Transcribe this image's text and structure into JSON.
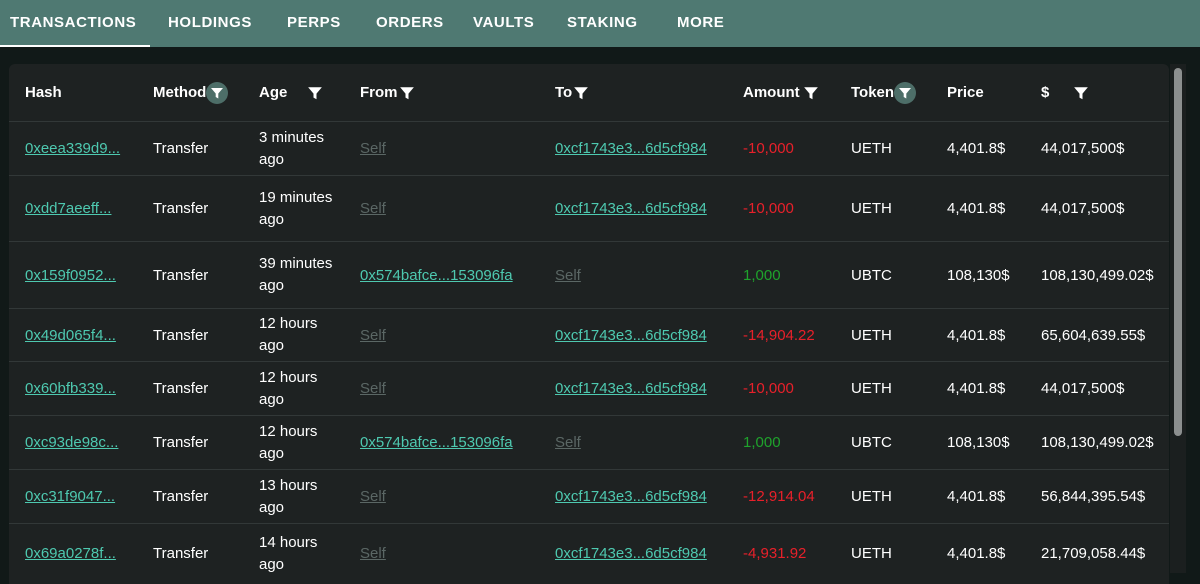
{
  "tabs": [
    {
      "label": "TRANSACTIONS"
    },
    {
      "label": "HOLDINGS"
    },
    {
      "label": "PERPS"
    },
    {
      "label": "ORDERS"
    },
    {
      "label": "VAULTS"
    },
    {
      "label": "STAKING"
    },
    {
      "label": "MORE"
    }
  ],
  "active_tab": "TRANSACTIONS",
  "colors": {
    "tabbar": "#4f7972",
    "link": "#4ec9b0",
    "negative": "#e8202a",
    "positive": "#1fa32c",
    "self_link": "#5b6765"
  },
  "table": {
    "headers": {
      "hash": "Hash",
      "method": "Method",
      "age": "Age",
      "from": "From",
      "to": "To",
      "amount": "Amount",
      "token": "Token",
      "price": "Price",
      "usd": "$"
    },
    "filter_icon": "funnel-icon",
    "rows": [
      {
        "hash": "0xeea339d9...",
        "method": "Transfer",
        "age": "3 minutes ago",
        "from": "Self",
        "to": "0xcf1743e3...6d5cf984",
        "amount": "-10,000",
        "token": "UETH",
        "price": "4,401.8$",
        "usd": "44,017,500$"
      },
      {
        "hash": "0xdd7aeeff...",
        "method": "Transfer",
        "age": "19 minutes ago",
        "from": "Self",
        "to": "0xcf1743e3...6d5cf984",
        "amount": "-10,000",
        "token": "UETH",
        "price": "4,401.8$",
        "usd": "44,017,500$"
      },
      {
        "hash": "0x159f0952...",
        "method": "Transfer",
        "age": "39 minutes ago",
        "from": "0x574bafce...153096fa",
        "to": "Self",
        "amount": "1,000",
        "token": "UBTC",
        "price": "108,130$",
        "usd": "108,130,499.02$"
      },
      {
        "hash": "0x49d065f4...",
        "method": "Transfer",
        "age": "12 hours ago",
        "from": "Self",
        "to": "0xcf1743e3...6d5cf984",
        "amount": "-14,904.22",
        "token": "UETH",
        "price": "4,401.8$",
        "usd": "65,604,639.55$"
      },
      {
        "hash": "0x60bfb339...",
        "method": "Transfer",
        "age": "12 hours ago",
        "from": "Self",
        "to": "0xcf1743e3...6d5cf984",
        "amount": "-10,000",
        "token": "UETH",
        "price": "4,401.8$",
        "usd": "44,017,500$"
      },
      {
        "hash": "0xc93de98c...",
        "method": "Transfer",
        "age": "12 hours ago",
        "from": "0x574bafce...153096fa",
        "to": "Self",
        "amount": "1,000",
        "token": "UBTC",
        "price": "108,130$",
        "usd": "108,130,499.02$"
      },
      {
        "hash": "0xc31f9047...",
        "method": "Transfer",
        "age": "13 hours ago",
        "from": "Self",
        "to": "0xcf1743e3...6d5cf984",
        "amount": "-12,914.04",
        "token": "UETH",
        "price": "4,401.8$",
        "usd": "56,844,395.54$"
      },
      {
        "hash": "0x69a0278f...",
        "method": "Transfer",
        "age": "14 hours ago",
        "from": "Self",
        "to": "0xcf1743e3...6d5cf984",
        "amount": "-4,931.92",
        "token": "UETH",
        "price": "4,401.8$",
        "usd": "21,709,058.44$"
      }
    ]
  }
}
